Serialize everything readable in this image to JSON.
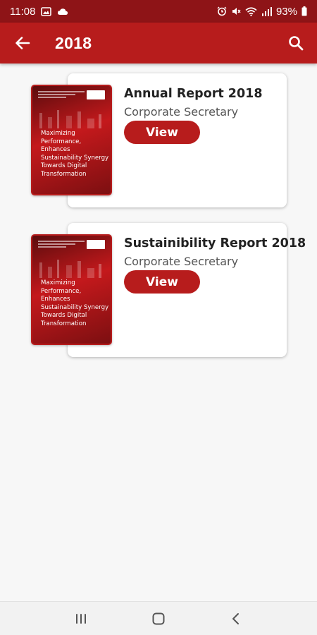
{
  "status_bar": {
    "time": "11:08",
    "battery": "93%",
    "left_icons": [
      "image-icon",
      "cloud-icon"
    ],
    "right_icons": [
      "alarm-icon",
      "mute-icon",
      "wifi-icon",
      "signal-icon",
      "battery-icon"
    ]
  },
  "app_bar": {
    "title": "2018",
    "back_icon": "arrow-left-icon",
    "search_icon": "search-icon",
    "color": "#b71c1c"
  },
  "reports": [
    {
      "title": "Annual Report 2018",
      "subtitle": "Corporate Secretary",
      "button_label": "View",
      "cover_text": "Maximizing Performance, Enhances Sustainability Synergy Towards Digital Transformation"
    },
    {
      "title": "Sustainibility Report 2018",
      "subtitle": "Corporate Secretary",
      "button_label": "View",
      "cover_text": "Maximizing Performance, Enhances Sustainability Synergy Towards Digital Transformation"
    }
  ],
  "nav_bar": {
    "recent_icon": "recent-apps-icon",
    "home_icon": "home-icon",
    "back_icon": "back-chevron-icon"
  },
  "colors": {
    "primary": "#b71c1c",
    "status_bar": "#8e1417",
    "background": "#f7f7f7"
  }
}
